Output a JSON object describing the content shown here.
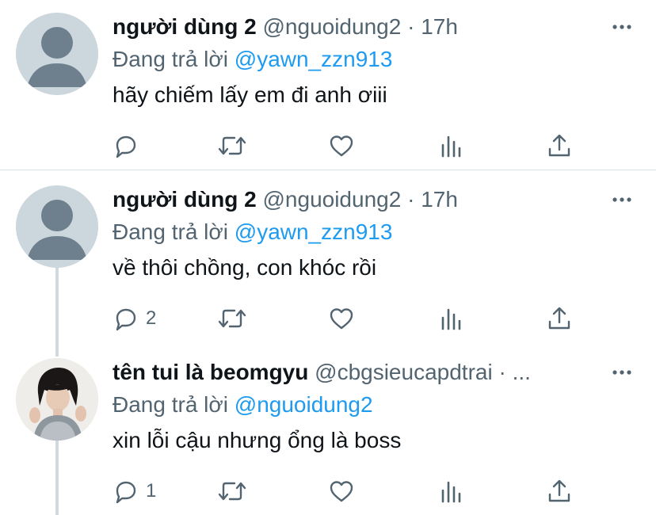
{
  "tweets": [
    {
      "name": "người dùng 2",
      "handle": "@nguoidung2",
      "sep": " · ",
      "time": "17h",
      "reply_prefix": "Đang trả lời",
      "reply_to": "@yawn_zzn913",
      "text": "hãy chiếm lấy em đi anh ơiii",
      "reply_count": "",
      "avatar": "default-avatar"
    },
    {
      "name": "người dùng 2",
      "handle": "@nguoidung2",
      "sep": " · ",
      "time": "17h",
      "reply_prefix": "Đang trả lời",
      "reply_to": "@yawn_zzn913",
      "text": "về thôi chồng, con khóc rồi",
      "reply_count": "2",
      "avatar": "default-avatar"
    },
    {
      "name": "tên tui là beomgyu",
      "handle": "@cbgsieucapdtrai",
      "sep": " · ",
      "time": "...",
      "reply_prefix": "Đang trả lời",
      "reply_to": "@nguoidung2",
      "text": "xin lỗi cậu nhưng ổng là boss",
      "reply_count": "1",
      "avatar": "photo-avatar"
    }
  ],
  "icons": [
    "more-icon",
    "reply-icon",
    "retweet-icon",
    "like-icon",
    "analytics-icon",
    "share-icon"
  ],
  "colors": {
    "text": "#0f1419",
    "secondary": "#536471",
    "link": "#1d9bf0",
    "divider": "#dbe2e7"
  }
}
